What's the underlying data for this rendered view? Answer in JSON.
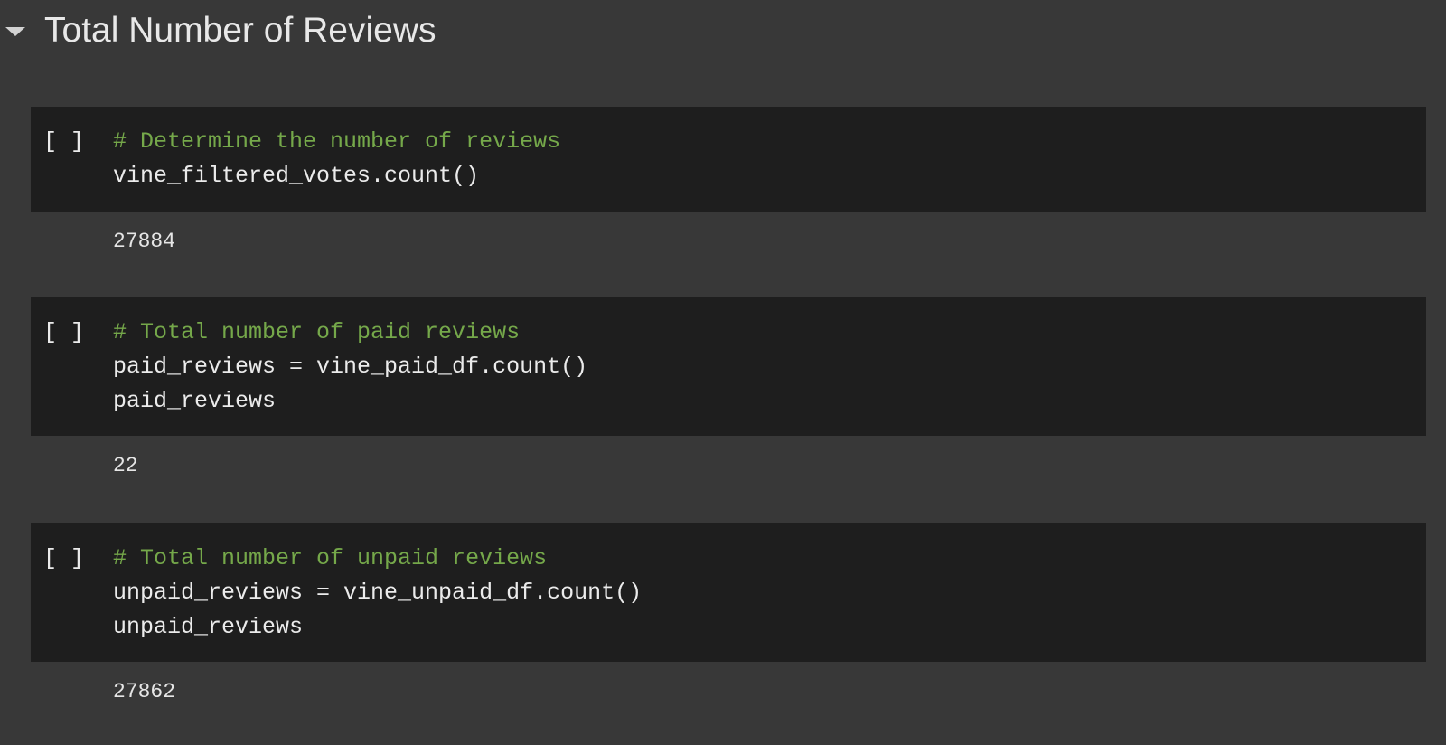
{
  "section": {
    "title": "Total Number of Reviews",
    "toggle_icon": "caret-down-icon"
  },
  "cells": [
    {
      "run_label": "[ ]",
      "code": {
        "comment": "# Determine the number of reviews",
        "lines": [
          "vine_filtered_votes.count()"
        ]
      },
      "output": "27884"
    },
    {
      "run_label": "[ ]",
      "code": {
        "comment": "# Total number of paid reviews",
        "lines": [
          "paid_reviews = vine_paid_df.count()",
          "paid_reviews"
        ]
      },
      "output": "22"
    },
    {
      "run_label": "[ ]",
      "code": {
        "comment": "# Total number of unpaid reviews",
        "lines": [
          "unpaid_reviews = vine_unpaid_df.count()",
          "unpaid_reviews"
        ]
      },
      "output": "27862"
    }
  ],
  "colors": {
    "page_background": "#383838",
    "code_background": "#1e1e1e",
    "comment": "#75a84a",
    "code_text": "#ebebeb"
  }
}
